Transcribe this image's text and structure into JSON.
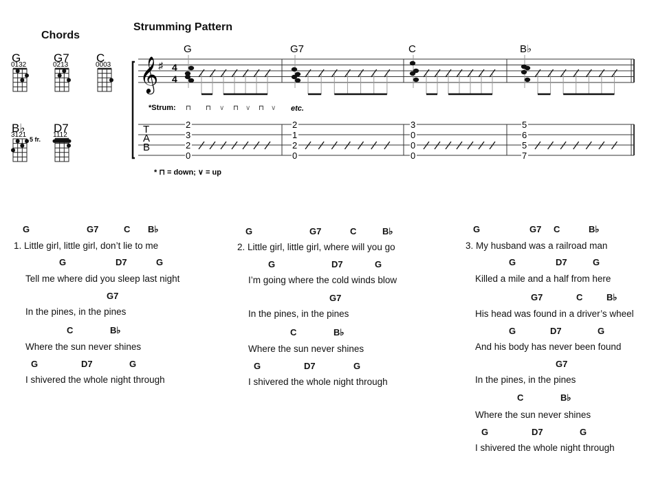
{
  "chords_section": {
    "title": "Chords",
    "diagrams": [
      {
        "name": "G",
        "fingering": "0132",
        "position": ""
      },
      {
        "name": "G7",
        "fingering": "0213",
        "position": ""
      },
      {
        "name": "C",
        "fingering": "0003",
        "position": ""
      },
      {
        "name": "B♭",
        "fingering": "3121",
        "position": "5 fr."
      },
      {
        "name": "D7",
        "fingering": "1112",
        "position": ""
      }
    ]
  },
  "strumming": {
    "title": "Strumming Pattern",
    "measures": [
      {
        "chord": "G",
        "tab": [
          "2",
          "3",
          "2",
          "0"
        ]
      },
      {
        "chord": "G7",
        "tab": [
          "2",
          "1",
          "2",
          "0"
        ]
      },
      {
        "chord": "C",
        "tab": [
          "3",
          "0",
          "0",
          "0"
        ]
      },
      {
        "chord": "B♭",
        "tab": [
          "5",
          "6",
          "5",
          "7"
        ]
      }
    ],
    "time_signature": "4/4",
    "strum_label": "*Strum:",
    "strums": [
      "down",
      "down",
      "up",
      "down",
      "up",
      "down",
      "up"
    ],
    "etc": "etc.",
    "footnote": "* ⊓ = down; ∨ = up",
    "tab_letters": [
      "T",
      "A",
      "B"
    ]
  },
  "verses": [
    {
      "lines": [
        {
          "chords": [
            "G",
            "G7",
            "C",
            "B♭"
          ],
          "lyric": "1. Little girl, little girl, don’t lie to me"
        },
        {
          "chords": [
            "G",
            "D7",
            "G"
          ],
          "lyric": "Tell me where did you sleep last night"
        },
        {
          "chords": [
            "G7"
          ],
          "lyric": "In the pines, in the pines"
        },
        {
          "chords": [
            "C",
            "B♭"
          ],
          "lyric": "Where the sun never shines"
        },
        {
          "chords": [
            "G",
            "D7",
            "G"
          ],
          "lyric": "I shivered the whole night through"
        }
      ]
    },
    {
      "lines": [
        {
          "chords": [
            "G",
            "G7",
            "C",
            "B♭"
          ],
          "lyric": "2. Little girl, little girl, where will you go"
        },
        {
          "chords": [
            "G",
            "D7",
            "G"
          ],
          "lyric": "I’m going where the cold winds blow"
        },
        {
          "chords": [
            "G7"
          ],
          "lyric": "In the pines, in the pines"
        },
        {
          "chords": [
            "C",
            "B♭"
          ],
          "lyric": "Where the sun never shines"
        },
        {
          "chords": [
            "G",
            "D7",
            "G"
          ],
          "lyric": "I shivered the whole night through"
        }
      ]
    },
    {
      "lines": [
        {
          "chords": [
            "G",
            "G7",
            "C",
            "B♭"
          ],
          "lyric": "3. My husband was a railroad man"
        },
        {
          "chords": [
            "G",
            "D7",
            "G"
          ],
          "lyric": "Killed a mile and a half from here"
        },
        {
          "chords": [
            "G7",
            "C",
            "B♭"
          ],
          "lyric": "His head was found in a driver’s wheel"
        },
        {
          "chords": [
            "G",
            "D7",
            "G"
          ],
          "lyric": "And his body has never been found"
        },
        {
          "chords": [
            "G7"
          ],
          "lyric": "In the pines, in the pines"
        },
        {
          "chords": [
            "C",
            "B♭"
          ],
          "lyric": "Where the sun never shines"
        },
        {
          "chords": [
            "G",
            "D7",
            "G"
          ],
          "lyric": "I shivered the whole night through"
        }
      ]
    }
  ]
}
